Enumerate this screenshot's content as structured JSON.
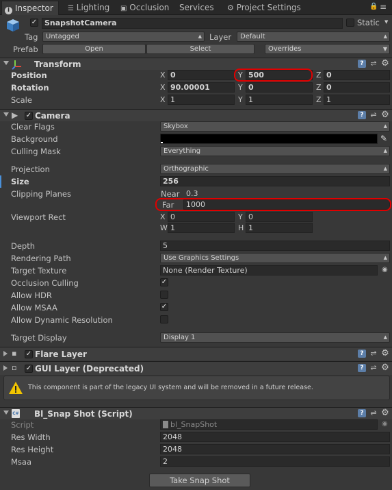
{
  "tabs": [
    {
      "label": "Inspector",
      "icon": "info-icon"
    },
    {
      "label": "Lighting",
      "icon": "lighting-icon"
    },
    {
      "label": "Occlusion",
      "icon": "occlusion-icon"
    },
    {
      "label": "Services"
    },
    {
      "label": "Project Settings",
      "icon": "gear-icon"
    }
  ],
  "object": {
    "name": "SnapshotCamera",
    "static_label": "Static",
    "tag_label": "Tag",
    "tag_value": "Untagged",
    "layer_label": "Layer",
    "layer_value": "Default",
    "prefab_label": "Prefab",
    "open_label": "Open",
    "select_label": "Select",
    "overrides_label": "Overrides"
  },
  "transform": {
    "title": "Transform",
    "position_label": "Position",
    "rotation_label": "Rotation",
    "scale_label": "Scale",
    "position": {
      "x": "0",
      "y": "500",
      "z": "0"
    },
    "rotation": {
      "x": "90.00001",
      "y": "0",
      "z": "0"
    },
    "scale": {
      "x": "1",
      "y": "1",
      "z": "1"
    },
    "axis_x": "X",
    "axis_y": "Y",
    "axis_z": "Z"
  },
  "camera": {
    "title": "Camera",
    "clear_flags_label": "Clear Flags",
    "clear_flags": "Skybox",
    "background_label": "Background",
    "background_color": "#000000",
    "culling_mask_label": "Culling Mask",
    "culling_mask": "Everything",
    "projection_label": "Projection",
    "projection": "Orthographic",
    "size_label": "Size",
    "size": "256",
    "clipping_label": "Clipping Planes",
    "near_label": "Near",
    "near": "0.3",
    "far_label": "Far",
    "far": "1000",
    "viewport_label": "Viewport Rect",
    "viewport": {
      "x_label": "X",
      "x": "0",
      "y_label": "Y",
      "y": "0",
      "w_label": "W",
      "w": "1",
      "h_label": "H",
      "h": "1"
    },
    "depth_label": "Depth",
    "depth": "5",
    "rendering_path_label": "Rendering Path",
    "rendering_path": "Use Graphics Settings",
    "target_texture_label": "Target Texture",
    "target_texture": "None (Render Texture)",
    "occlusion_culling_label": "Occlusion Culling",
    "allow_hdr_label": "Allow HDR",
    "allow_msaa_label": "Allow MSAA",
    "allow_dynamic_label": "Allow Dynamic Resolution",
    "target_display_label": "Target Display",
    "target_display": "Display 1",
    "checks": {
      "occlusion_culling": true,
      "allow_hdr": false,
      "allow_msaa": true,
      "allow_dynamic": false
    }
  },
  "flare_layer": {
    "title": "Flare Layer"
  },
  "gui_layer": {
    "title": "GUI Layer (Deprecated)",
    "warning": "This component is part of the legacy UI system and will be removed in a future release."
  },
  "script": {
    "title": "Bl_Snap Shot (Script)",
    "script_label": "Script",
    "script_value": "bl_SnapShot",
    "res_width_label": "Res Width",
    "res_width": "2048",
    "res_height_label": "Res Height",
    "res_height": "2048",
    "msaa_label": "Msaa",
    "msaa": "2",
    "button_label": "Take Snap Shot"
  },
  "colors": {
    "highlight": "#e00000",
    "help_icon": "#5c7ea8",
    "warning": "#f2c500"
  }
}
